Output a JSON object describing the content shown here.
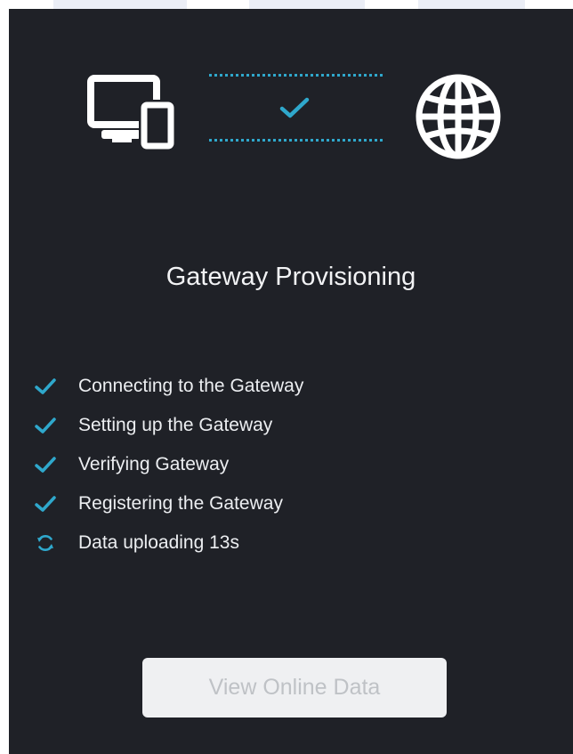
{
  "title": "Gateway Provisioning",
  "steps": [
    {
      "label": "Connecting to the Gateway",
      "status": "done",
      "icon": "check-icon"
    },
    {
      "label": "Setting up the Gateway",
      "status": "done",
      "icon": "check-icon"
    },
    {
      "label": "Verifying Gateway",
      "status": "done",
      "icon": "check-icon"
    },
    {
      "label": "Registering the Gateway",
      "status": "done",
      "icon": "check-icon"
    },
    {
      "label": "Data uploading 13s",
      "status": "in-progress",
      "icon": "sync-icon"
    }
  ],
  "connection": {
    "left_icon": "devices-icon",
    "right_icon": "globe-icon",
    "status_icon": "check-icon"
  },
  "button": {
    "label": "View Online Data"
  },
  "colors": {
    "background": "#1f2127",
    "accent": "#2fa8cc",
    "text": "#eceef1",
    "button_bg": "#eff0f2",
    "button_text": "#bfc2c6"
  }
}
